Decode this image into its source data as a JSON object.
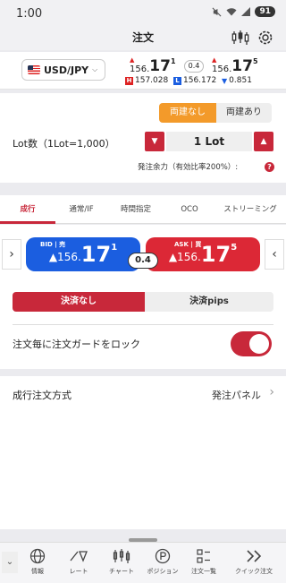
{
  "status": {
    "time": "1:00",
    "battery": "91"
  },
  "header": {
    "title": "注文"
  },
  "quote": {
    "pair": "USD/JPY",
    "bid": {
      "small": "156.",
      "big": "17",
      "sup": "1"
    },
    "ask": {
      "small": "156.",
      "big": "17",
      "sup": "5"
    },
    "spread": "0.4",
    "high_badge": "H",
    "high": "157.028",
    "low_badge": "L",
    "low": "156.172",
    "change_arrow": "▼",
    "change": "0.851"
  },
  "lot": {
    "hedge_off": "両建なし",
    "hedge_on": "両建あり",
    "label": "Lot数（1Lot=1,000）",
    "value": "1 Lot",
    "minus": "▼",
    "plus": "▲",
    "margin_label": "発注余力（有効比率200%）:",
    "help": "?"
  },
  "tabs": [
    "成行",
    "通常/IF",
    "時間指定",
    "OCO",
    "ストリーミング"
  ],
  "trade": {
    "left_arrow": "›",
    "right_arrow": "‹",
    "bid_label": "BID | 売",
    "bid_small": "▲156.",
    "bid_big": "17",
    "bid_sup": "1",
    "ask_label": "ASK | 買",
    "ask_small": "▲156.",
    "ask_big": "17",
    "ask_sup": "5",
    "spread": "0.4",
    "settle_off": "決済なし",
    "settle_pips": "決済pips",
    "lock_label": "注文毎に注文ガードをロック",
    "order_method_label": "成行注文方式",
    "order_method_value": "発注パネル",
    "order_chevron": "›"
  },
  "nav": {
    "collapse": "⌄",
    "items": [
      "情報",
      "レート",
      "チャート",
      "ポジション",
      "注文一覧",
      "クイック注文"
    ]
  },
  "colors": {
    "accent": "#c8283a",
    "bid": "#1b5ee0",
    "ask": "#dc2836",
    "hedge": "#f39a2a"
  }
}
